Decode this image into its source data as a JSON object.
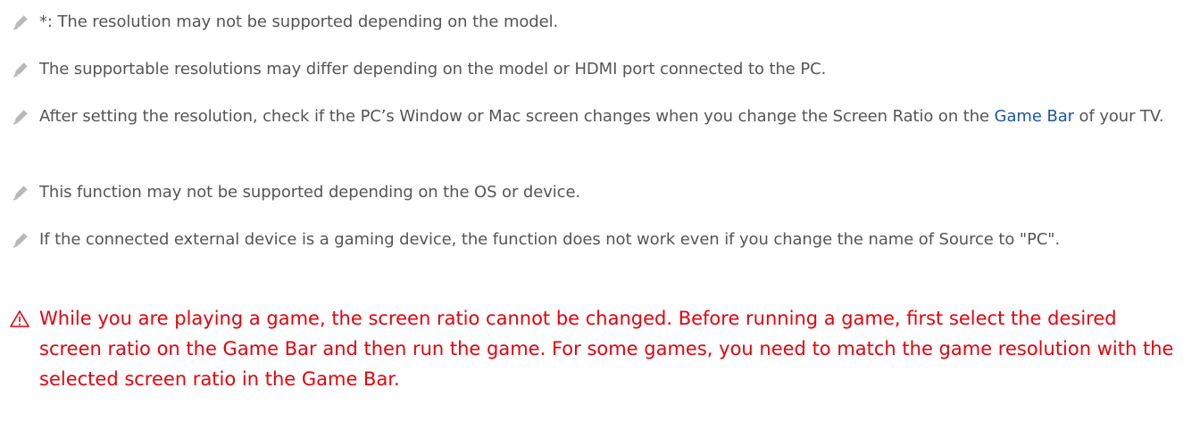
{
  "notes": [
    {
      "text": "*: The resolution may not be supported depending on the model.",
      "icon": "pencil-note-icon"
    },
    {
      "text": "The supportable resolutions may differ depending on the model or HDMI port connected to the PC.",
      "icon": "pencil-note-icon"
    },
    {
      "text_before": "After setting the resolution, check if the PC’s Window or Mac screen changes when you change the Screen Ratio on the ",
      "link": "Game Bar",
      "text_after": " of your TV.",
      "icon": "pencil-note-icon"
    },
    {
      "text": "This function may not be supported depending on the OS or device.",
      "icon": "pencil-note-icon"
    },
    {
      "text": "If the connected external device is a gaming device, the function does not work even if you change the name of Source to \"PC\".",
      "icon": "pencil-note-icon"
    }
  ],
  "caution": {
    "icon": "warning-triangle-icon",
    "text": "While you are playing a game, the screen ratio cannot be changed. Before running a game, first select the desired screen ratio on the Game Bar and then run the game. For some games, you need to match the game resolution with the selected screen ratio in the Game Bar."
  },
  "colors": {
    "body_text": "#555555",
    "link": "#1a56a8",
    "caution": "#e8000b",
    "icon": "#a8a8a8"
  }
}
